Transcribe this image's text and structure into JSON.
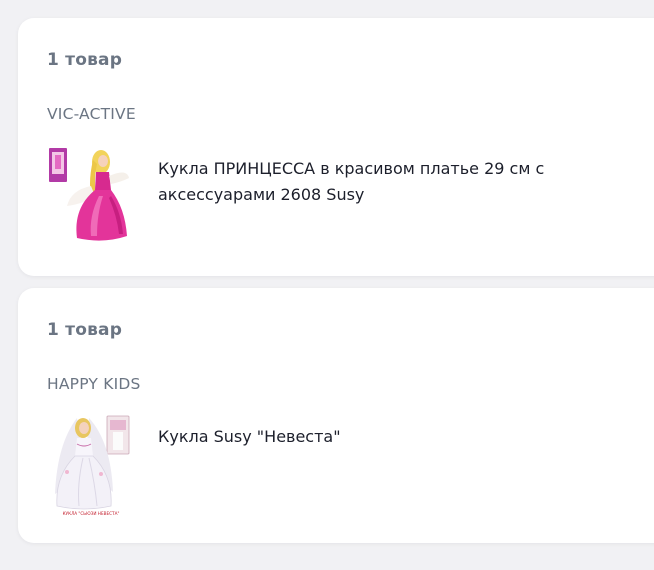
{
  "orders": [
    {
      "count_label": "1 товар",
      "seller": "VIC-ACTIVE",
      "product": {
        "title": "Кукла ПРИНЦЕССА в красивом платье 29 см с аксессуарами 2608 Susy",
        "image_alt": "doll-in-pink-dress-image"
      }
    },
    {
      "count_label": "1 товар",
      "seller": "HAPPY KIDS",
      "product": {
        "title": "Кукла Susy \"Невеста\"",
        "image_alt": "bride-doll-image",
        "image_caption": "КУКЛА \"СЬЮЗИ НЕВЕСТА\""
      }
    }
  ],
  "colors": {
    "background": "#f1f1f4",
    "card": "#ffffff",
    "muted_text": "#6b7583",
    "title_text": "#1c1f2b",
    "accent_pink": "#e3349a"
  }
}
